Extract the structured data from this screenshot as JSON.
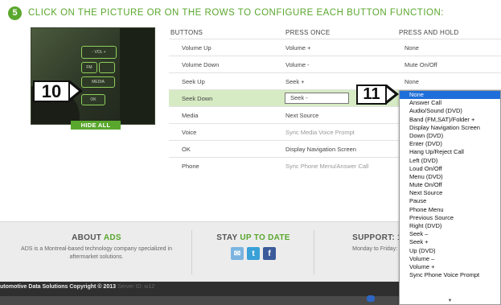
{
  "header": {
    "step": "5",
    "title": "CLICK ON THE PICTURE OR ON THE ROWS TO CONFIGURE EACH BUTTON FUNCTION:"
  },
  "picture": {
    "buttons": [
      "- VOL +",
      "FM",
      "MEDIA",
      "OK"
    ],
    "hide_all_label": "HIDE ALL",
    "callout_left": "10",
    "callout_right": "11"
  },
  "table": {
    "columns": [
      "BUTTONS",
      "PRESS ONCE",
      "PRESS AND HOLD"
    ],
    "rows": [
      {
        "button": "Volume Up",
        "press_once": "Volume +",
        "press_hold": "None"
      },
      {
        "button": "Volume Down",
        "press_once": "Volume -",
        "press_hold": "Mute On/Off"
      },
      {
        "button": "Seek Up",
        "press_once": "Seek +",
        "press_hold": "None"
      },
      {
        "button": "Seek Down",
        "press_once": "Seek -",
        "press_hold": ""
      },
      {
        "button": "Media",
        "press_once": "Next Source",
        "press_hold": ""
      },
      {
        "button": "Voice",
        "press_once": "Sync Media Voice Prompt",
        "press_hold": ""
      },
      {
        "button": "OK",
        "press_once": "Display Navigation Screen",
        "press_hold": ""
      },
      {
        "button": "Phone",
        "press_once": "Sync Phone Menu/Answer Call",
        "press_hold": ""
      }
    ]
  },
  "dropdown": {
    "options": [
      "None",
      "Answer Call",
      "Audio/Sound (DVD)",
      "Band (FM,SAT)/Folder +",
      "Display Navigation Screen",
      "Down (DVD)",
      "Enter (DVD)",
      "Hang Up/Reject Call",
      "Left (DVD)",
      "Loud On/Off",
      "Menu (DVD)",
      "Mute On/Off",
      "Next Source",
      "Pause",
      "Phone Menu",
      "Previous Source",
      "Right (DVD)",
      "Seek –",
      "Seek +",
      "Up (DVD)",
      "Volume –",
      "Volume +",
      "Sync Phone Voice Prompt"
    ],
    "selected": "None",
    "scroll_icon": "down-triangle"
  },
  "footer": {
    "about": {
      "title_plain": "ABOUT ",
      "title_green": "ADS",
      "text": "ADS is a Montreal-based technology company specialized in aftermarket solutions."
    },
    "stay": {
      "title_plain": "STAY ",
      "title_green": "UP TO DATE"
    },
    "support": {
      "title": "SUPPORT: 1",
      "text": "Monday to Friday: 8"
    },
    "copyright": "utomotive Data Solutions Copyright © 2013",
    "server": "Server ID: w12"
  },
  "colors": {
    "accent": "#5aa72e",
    "selection": "#1e6fd9",
    "row_highlight": "#d6ebc3"
  }
}
